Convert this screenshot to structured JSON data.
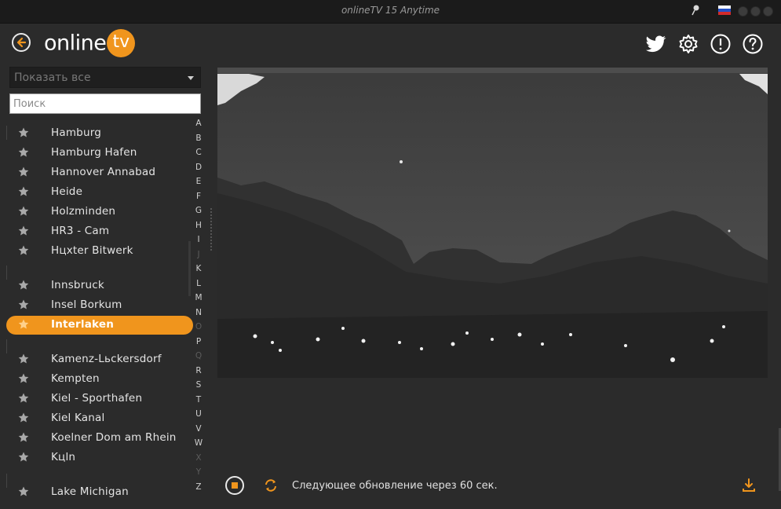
{
  "window": {
    "title": "onlineTV 15 Anytime"
  },
  "header": {
    "logo_text": "online",
    "logo_badge": "tv"
  },
  "filter": {
    "selected": "Показать все"
  },
  "search": {
    "placeholder": "Поиск"
  },
  "list": {
    "items": [
      {
        "label": "Hamburg",
        "selected": false
      },
      {
        "label": "Hamburg Hafen",
        "selected": false
      },
      {
        "label": "Hannover Annabad",
        "selected": false
      },
      {
        "label": "Heide",
        "selected": false
      },
      {
        "label": "Holzminden",
        "selected": false
      },
      {
        "label": "HR3 - Cam",
        "selected": false
      },
      {
        "label": "Hцxter Bitwerk",
        "selected": false
      },
      {
        "label": "Innsbruck",
        "selected": false
      },
      {
        "label": "Insel Borkum",
        "selected": false
      },
      {
        "label": "Interlaken",
        "selected": true
      },
      {
        "label": "Kamenz-Lьckersdorf",
        "selected": false
      },
      {
        "label": "Kempten",
        "selected": false
      },
      {
        "label": "Kiel - Sporthafen",
        "selected": false
      },
      {
        "label": "Kiel Kanal",
        "selected": false
      },
      {
        "label": "Koelner Dom am Rhein",
        "selected": false
      },
      {
        "label": "Kцln",
        "selected": false
      },
      {
        "label": "Lake Michigan",
        "selected": false
      }
    ]
  },
  "alphabet": {
    "letters": [
      "A",
      "B",
      "C",
      "D",
      "E",
      "F",
      "G",
      "H",
      "I",
      "J",
      "K",
      "L",
      "M",
      "N",
      "O",
      "P",
      "Q",
      "R",
      "S",
      "T",
      "U",
      "V",
      "W",
      "X",
      "Y",
      "Z"
    ],
    "disabled": [
      "J",
      "O",
      "Q",
      "X",
      "Y"
    ]
  },
  "controls": {
    "status_text": "Следующее обновление через 60 сек."
  },
  "colors": {
    "accent": "#f0951d",
    "background": "#2b2b2b",
    "titlebar": "#1b1b1b"
  },
  "icons": {
    "back": "back-arrow-icon",
    "twitter": "twitter-icon",
    "settings": "gear-icon",
    "info": "exclamation-icon",
    "help": "question-icon",
    "stop": "stop-icon",
    "refresh": "refresh-icon",
    "download": "download-icon",
    "favorite": "star-icon"
  }
}
